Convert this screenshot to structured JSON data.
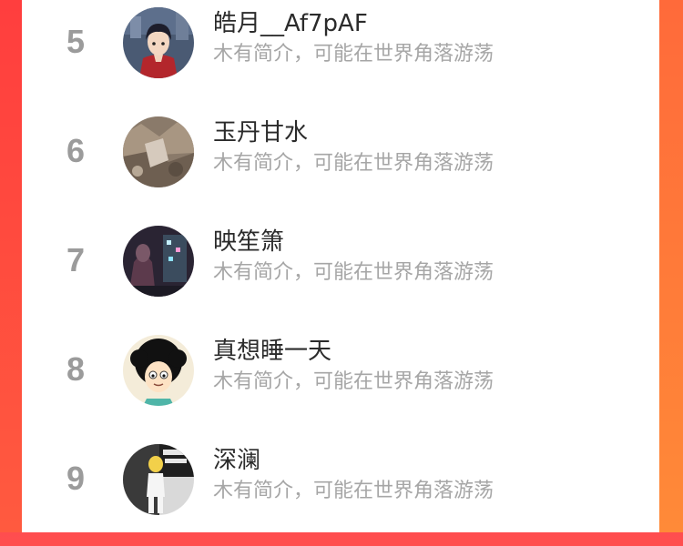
{
  "colors": {
    "accent": "#ff5a3f",
    "rank": "#9b9b9b",
    "name": "#2b2b2b",
    "bio": "#a6a6a6"
  },
  "list": {
    "items": [
      {
        "rank": "5",
        "name": "皓月__Af7pAF",
        "bio": "木有简介，可能在世界角落游荡",
        "avatar_icon": "anime-boy-avatar"
      },
      {
        "rank": "6",
        "name": "玉丹甘水",
        "bio": "木有简介，可能在世界角落游荡",
        "avatar_icon": "rocky-photo-avatar"
      },
      {
        "rank": "7",
        "name": "映笙箫",
        "bio": "木有简介，可能在世界角落游荡",
        "avatar_icon": "night-street-avatar"
      },
      {
        "rank": "8",
        "name": "真想睡一天",
        "bio": "木有简介，可能在世界角落游荡",
        "avatar_icon": "afro-cartoon-avatar"
      },
      {
        "rank": "9",
        "name": "深澜",
        "bio": "木有简介，可能在世界角落游荡",
        "avatar_icon": "yellow-figure-avatar"
      }
    ]
  }
}
